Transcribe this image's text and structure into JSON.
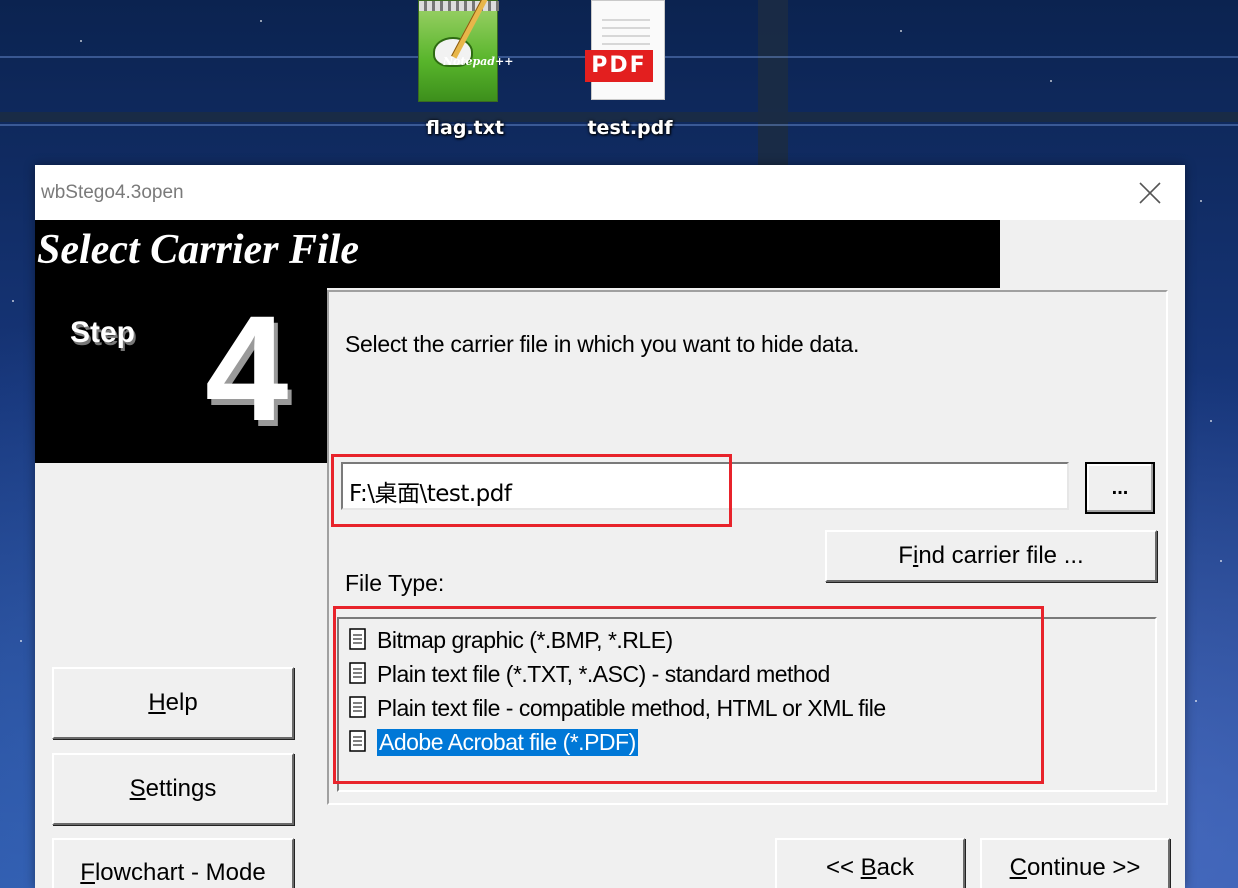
{
  "desktop": {
    "icons": [
      {
        "label": "flag.txt",
        "icon": "notepad-icon"
      },
      {
        "label": "test.pdf",
        "icon": "pdf-icon",
        "badge": "PDF"
      }
    ]
  },
  "window": {
    "title": "wbStego4.3open",
    "close_icon": "close-icon",
    "header_title": "Select Carrier File",
    "step_word": "Step",
    "step_number": "4",
    "instruction": "Select the carrier file in which you want to hide data.",
    "file_path": "F:\\桌面\\test.pdf",
    "browse_label": "...",
    "find_button": {
      "prefix": "F",
      "underlined": "i",
      "suffix": "nd carrier file ..."
    },
    "file_type_label": "File Type:",
    "file_types": [
      {
        "label": "Bitmap graphic (*.BMP, *.RLE)",
        "selected": false
      },
      {
        "label": "Plain text file (*.TXT, *.ASC) - standard method",
        "selected": false
      },
      {
        "label": "Plain text file - compatible method, HTML or XML file",
        "selected": false
      },
      {
        "label": "Adobe Acrobat file (*.PDF)",
        "selected": true
      }
    ],
    "buttons": {
      "help": {
        "underlined": "H",
        "rest": "elp"
      },
      "settings": {
        "underlined": "S",
        "rest": "ettings"
      },
      "flowchart": {
        "underlined": "F",
        "rest": "lowchart - Mode"
      },
      "back": {
        "prefix": "<< ",
        "underlined": "B",
        "rest": "ack"
      },
      "continue": {
        "underlined": "C",
        "rest": "ontinue >>"
      }
    }
  },
  "colors": {
    "highlight_box": "#e8232b",
    "selection": "#0078d7",
    "header_bg": "#000000",
    "window_bg": "#f0f0f0"
  }
}
